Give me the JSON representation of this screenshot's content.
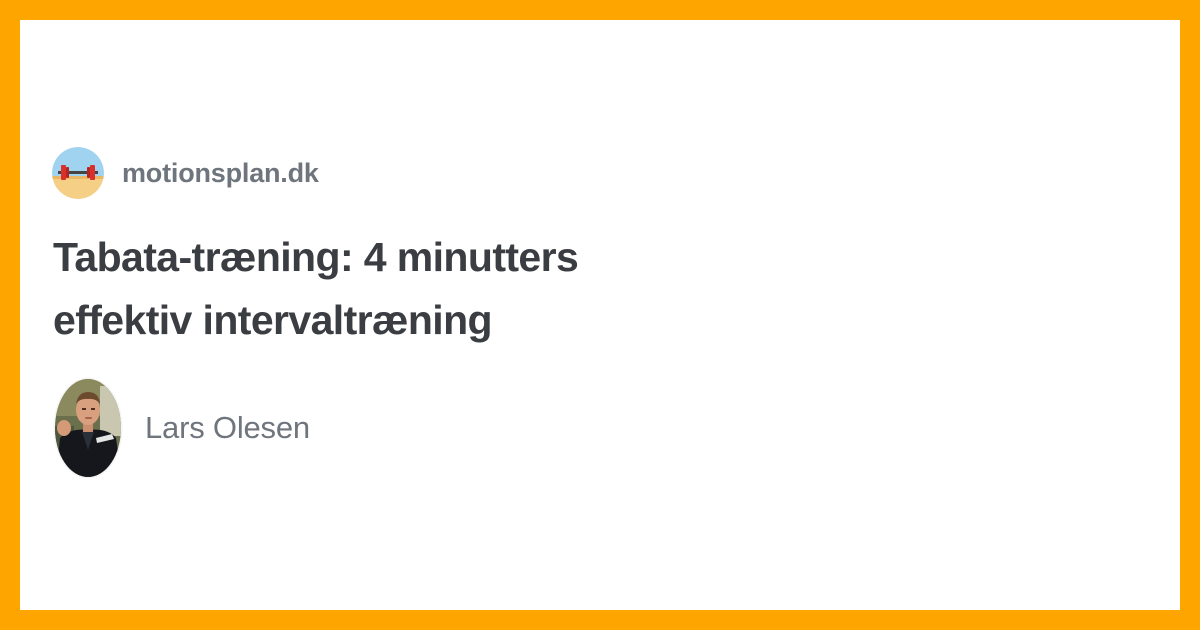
{
  "site": {
    "logo_icon": "barbell-beach-logo-icon",
    "name": "motionsplan.dk"
  },
  "article": {
    "title": "Tabata-træning: 4 minutters effektiv intervaltræning"
  },
  "author": {
    "avatar_icon": "author-photo-avatar",
    "name": "Lars Olesen"
  },
  "colors": {
    "frame": "#FFA500",
    "card": "#FFFFFF",
    "title_text": "#3A3D42",
    "secondary_text": "#6F757C"
  }
}
